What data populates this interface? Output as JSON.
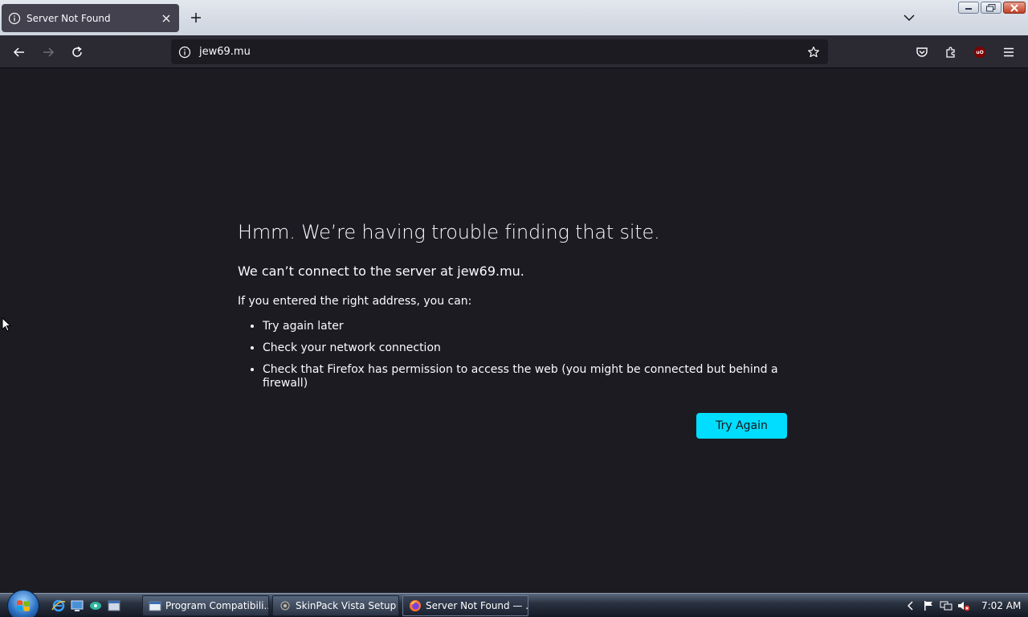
{
  "browser": {
    "tab": {
      "title": "Server Not Found"
    },
    "url": "jew69.mu"
  },
  "error": {
    "title": "Hmm. We’re having trouble finding that site.",
    "description": "We can’t connect to the server at jew69.mu.",
    "hint": "If you entered the right address, you can:",
    "suggestions": [
      "Try again later",
      "Check your network connection",
      "Check that Firefox has permission to access the web (you might be connected but behind a firewall)"
    ],
    "button_label": "Try Again",
    "accent_color": "#00ddff"
  },
  "extensions": {
    "ublock_label": "uO"
  },
  "taskbar": {
    "tasks": [
      {
        "label": "Program Compatibili..."
      },
      {
        "label": "SkinPack Vista Setup"
      },
      {
        "label": "Server Not Found — ..."
      }
    ],
    "clock": "7:02 AM"
  },
  "icons": {
    "tab": [
      "info-icon",
      "close-icon"
    ],
    "toolbar": [
      "back-arrow-icon",
      "forward-arrow-icon",
      "reload-icon",
      "star-icon",
      "pocket-icon",
      "extensions-puzzle-icon",
      "ublock-icon",
      "menu-hamburger-icon"
    ]
  }
}
